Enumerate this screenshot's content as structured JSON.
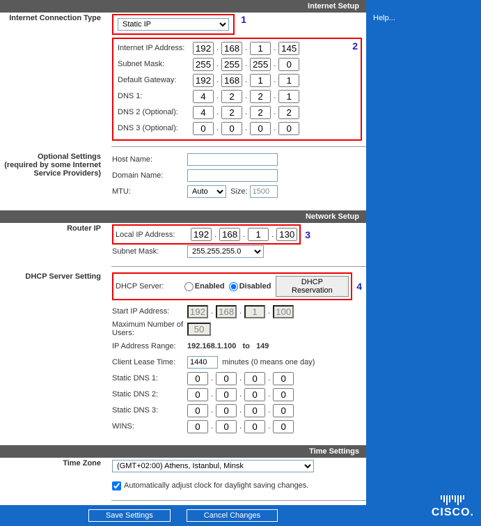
{
  "sidebar": {
    "help": "Help..."
  },
  "annot": {
    "n1": "1",
    "n2": "2",
    "n3": "3",
    "n4": "4"
  },
  "internet": {
    "header": "Internet Setup",
    "conn_type_label": "Internet Connection Type",
    "conn_type_value": "Static IP",
    "ipaddr_label": "Internet IP Address:",
    "ipaddr": [
      "192",
      "168",
      "1",
      "145"
    ],
    "subnet_label": "Subnet Mask:",
    "subnet": [
      "255",
      "255",
      "255",
      "0"
    ],
    "gateway_label": "Default Gateway:",
    "gateway": [
      "192",
      "168",
      "1",
      "1"
    ],
    "dns1_label": "DNS 1:",
    "dns1": [
      "4",
      "2",
      "2",
      "1"
    ],
    "dns2_label": "DNS 2 (Optional):",
    "dns2": [
      "4",
      "2",
      "2",
      "2"
    ],
    "dns3_label": "DNS 3 (Optional):",
    "dns3": [
      "0",
      "0",
      "0",
      "0"
    ]
  },
  "optional": {
    "label": "Optional Settings (required by some Internet Service Providers)",
    "hostname_label": "Host Name:",
    "hostname": "",
    "domain_label": "Domain Name:",
    "domain": "",
    "mtu_label": "MTU:",
    "mtu_mode": "Auto",
    "size_label": "Size:",
    "size": "1500"
  },
  "network": {
    "header": "Network Setup",
    "router_ip_label": "Router IP",
    "local_ip_label": "Local IP Address:",
    "local_ip": [
      "192",
      "168",
      "1",
      "130"
    ],
    "subnet_label": "Subnet Mask:",
    "subnet": "255.255.255.0"
  },
  "dhcp": {
    "label": "DHCP Server Setting",
    "server_label": "DHCP Server:",
    "enabled": "Enabled",
    "disabled": "Disabled",
    "reservation": "DHCP Reservation",
    "start_label": "Start IP Address:",
    "start": [
      "192",
      "168",
      "1",
      "100"
    ],
    "max_label": "Maximum Number of Users:",
    "max": "50",
    "range_label": "IP Address Range:",
    "range_value": "192.168.1.100   to   149",
    "lease_label": "Client Lease Time:",
    "lease": "1440",
    "lease_unit": "minutes (0 means one day)",
    "sdns1_label": "Static DNS 1:",
    "sdns1": [
      "0",
      "0",
      "0",
      "0"
    ],
    "sdns2_label": "Static DNS 2:",
    "sdns2": [
      "0",
      "0",
      "0",
      "0"
    ],
    "sdns3_label": "Static DNS 3:",
    "sdns3": [
      "0",
      "0",
      "0",
      "0"
    ],
    "wins_label": "WINS:",
    "wins": [
      "0",
      "0",
      "0",
      "0"
    ]
  },
  "time": {
    "header": "Time Settings",
    "tz_label": "Time Zone",
    "tz_value": "(GMT+02:00) Athens, Istanbul, Minsk",
    "dst_label": "Automatically adjust clock for daylight saving changes."
  },
  "footer": {
    "save": "Save Settings",
    "cancel": "Cancel Changes"
  }
}
